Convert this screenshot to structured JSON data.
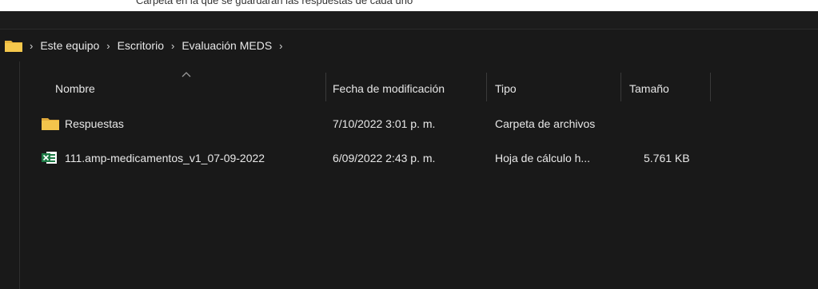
{
  "top_strip_text": "Carpeta en la que se guardarán las respuestas de cada uno",
  "breadcrumb": {
    "items": [
      "Este equipo",
      "Escritorio",
      "Evaluación MEDS"
    ],
    "separator": "›"
  },
  "columns": [
    "Nombre",
    "Fecha de modificación",
    "Tipo",
    "Tamaño"
  ],
  "files": [
    {
      "icon": "folder-icon",
      "name": "Respuestas",
      "modified": "7/10/2022 3:01 p. m.",
      "type": "Carpeta de archivos",
      "size": ""
    },
    {
      "icon": "excel-file-icon",
      "name": "111.amp-medicamentos_v1_07-09-2022",
      "modified": "6/09/2022 2:43 p. m.",
      "type": "Hoja de cálculo h...",
      "size": "5.761 KB"
    }
  ],
  "colors": {
    "background": "#191919",
    "text": "#e8e8e8",
    "folder": "#f2c24a",
    "excel": "#1d7a45"
  }
}
